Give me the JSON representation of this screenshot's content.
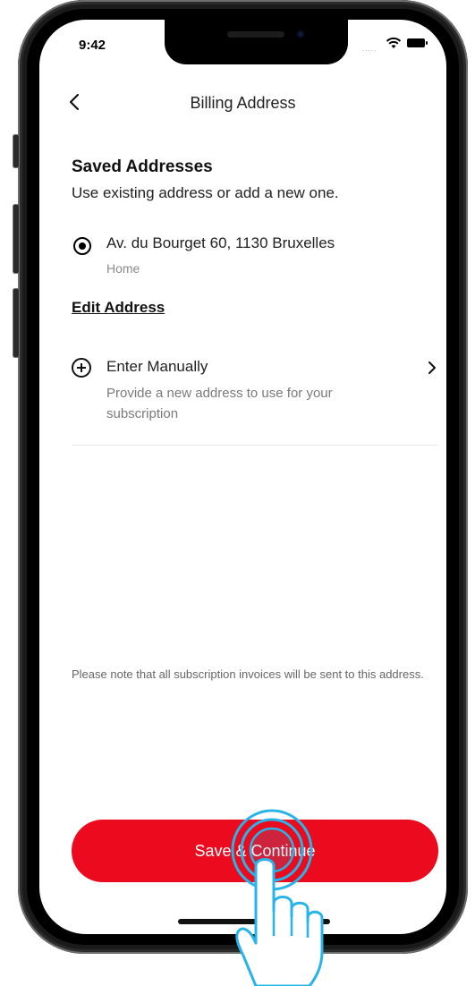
{
  "status_bar": {
    "time": "9:42",
    "signal": "....."
  },
  "nav": {
    "title": "Billing Address"
  },
  "saved": {
    "title": "Saved Addresses",
    "subtitle": "Use existing address or add a new one."
  },
  "address": {
    "line": "Av. du Bourget 60, 1130 Bruxelles",
    "label": "Home",
    "selected": true
  },
  "edit_label": "Edit Address",
  "manual": {
    "title": "Enter Manually",
    "description": "Provide a new address to use for your subscription"
  },
  "notice": "Please note that all subscription invoices will be sent to this address.",
  "primary_button": {
    "label": "Save & Continue",
    "color": "#eb0a1e"
  },
  "icons": {
    "back": "chevron-left-icon",
    "radio": "radio-selected-icon",
    "add": "plus-circle-icon",
    "forward": "chevron-right-icon",
    "tap_hint": "hand-pointer-icon"
  }
}
